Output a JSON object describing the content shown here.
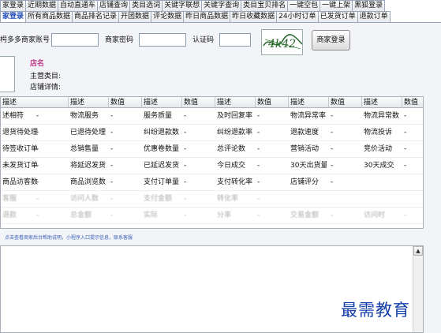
{
  "tabs_row1": [
    "家登录",
    "近期数据",
    "自动直通车",
    "店铺查询",
    "类目选词",
    "关键字联想",
    "关键字查询",
    "类目宝贝排名",
    "一键空包",
    "一键上架",
    "黑狐登录"
  ],
  "tabs_row2": [
    "家登录",
    "所有商品数据",
    "商品排名记录",
    "开团数据",
    "评论数据",
    "昨日商品数据",
    "昨日收藏数据",
    "24小时订单",
    "已发货订单",
    "退款订单"
  ],
  "active_tab_row2": 0,
  "login": {
    "account_label": "枵多多商家账号",
    "account_value": "",
    "password_label": "商家密码",
    "password_value": "",
    "code_label": "认证码",
    "code_value": "",
    "captcha_text": "4k42",
    "login_button": "商家登录"
  },
  "shop": {
    "name_label": "店名",
    "category_label": "主营类目:",
    "details_label": "店铺详情:"
  },
  "grid": {
    "headers": [
      "描述",
      "描述",
      "数值",
      "描述",
      "数值",
      "描述",
      "数值",
      "描述",
      "数值",
      "描述",
      "数值"
    ],
    "rows": [
      [
        "述相符",
        "-",
        "物流服务",
        "-",
        "服务质量",
        "-",
        "及时回复率",
        "-",
        "物流异常率",
        "-",
        "物流异常数",
        "-"
      ],
      [
        "退货待处理",
        "-",
        "已退待处理",
        "-",
        "纠纷退款数",
        "-",
        "纠纷退款率",
        "-",
        "退款速度",
        "-",
        "物流投诉",
        "-"
      ],
      [
        "待签收订单",
        "-",
        "总销售量",
        "-",
        "优惠卷数量",
        "-",
        "总评论数",
        "-",
        "营销活动",
        "-",
        "竞价活动",
        "-"
      ],
      [
        "未发货订单",
        "-",
        "将延迟发货",
        "-",
        "已延迟发货",
        "-",
        "今日成交",
        "-",
        "30天出货量",
        "-",
        "30天成交",
        "-"
      ],
      [
        "商品访客数",
        "-",
        "商品浏览数",
        "-",
        "支付订单量",
        "-",
        "支付转化率",
        "-",
        "店铺评分",
        "-",
        "",
        ""
      ],
      [
        "客服",
        "-",
        "访问人数",
        "-",
        "支付金额",
        "-",
        "转化率",
        "-",
        "",
        "",
        "",
        ""
      ],
      [
        "退款",
        "-",
        "总金额",
        "-",
        "实际",
        "-",
        "分率",
        "-",
        "交易金额",
        "-",
        "访问时",
        "-"
      ]
    ]
  },
  "link_text": "点击查看商家后台帮助说明，小程序入口提示信息，联系客服",
  "watermark": "最需教育",
  "colors": {
    "tab_active": "#1e48b8",
    "shop_name": "#c03c8a",
    "watermark": "#143ea8"
  }
}
